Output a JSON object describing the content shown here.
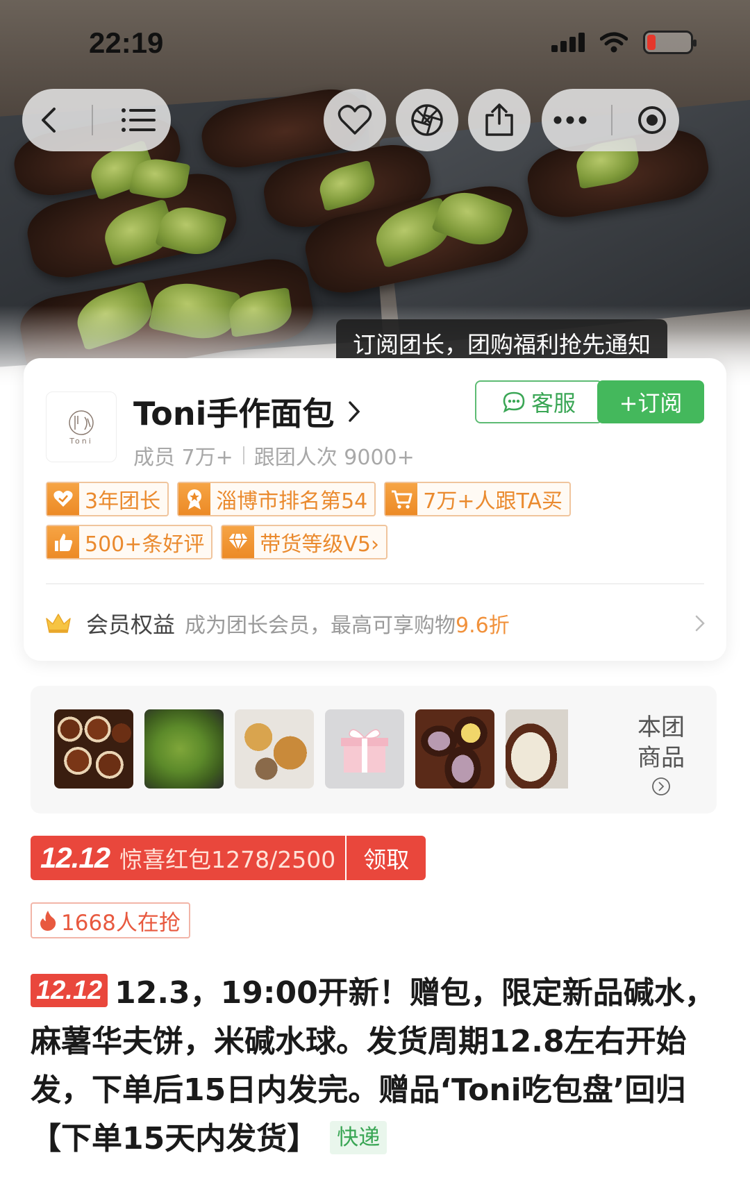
{
  "status_bar": {
    "time": "22:19"
  },
  "tooltip": {
    "text": "订阅团长，团购福利抢先通知"
  },
  "store": {
    "logo_text": "Toni",
    "name": "Toni手作面包",
    "members": "成员 7万+",
    "participations": "跟团人次 9000+",
    "service_label": "客服",
    "subscribe_label": "+订阅",
    "badges_row1": [
      "3年团长",
      "淄博市排名第54",
      "7万+人跟TA买"
    ],
    "badges_row2": [
      "500+条好评",
      "带货等级V5›"
    ],
    "member_title": "会员权益",
    "member_desc_prefix": "成为团长会员，最高可享购物",
    "member_desc_highlight": "9.6折"
  },
  "goods": {
    "more_label_line1": "本团",
    "more_label_line2": "商品"
  },
  "promo": {
    "logo": "12.12",
    "text": "惊喜红包1278/2500",
    "claim_label": "领取",
    "hot_text": "1668人在抢"
  },
  "description": {
    "tag": "12.12",
    "text": "12.3，19:00开新！赠包，限定新品碱水，麻薯华夫饼，米碱水球。发货周期12.8左右开始发，下单后15日内发完。赠品‘Toni吃包盘’回归【下单15天内发货】",
    "shipping": "快递"
  },
  "colors": {
    "accent_green": "#44b85c",
    "accent_red": "#e9473c",
    "badge_orange": "#ea8a2e"
  },
  "icons": [
    "back-icon",
    "menu-icon",
    "heart-icon",
    "aperture-icon",
    "share-icon",
    "more-icon",
    "target-icon",
    "chat-icon",
    "chevron-right-icon"
  ]
}
